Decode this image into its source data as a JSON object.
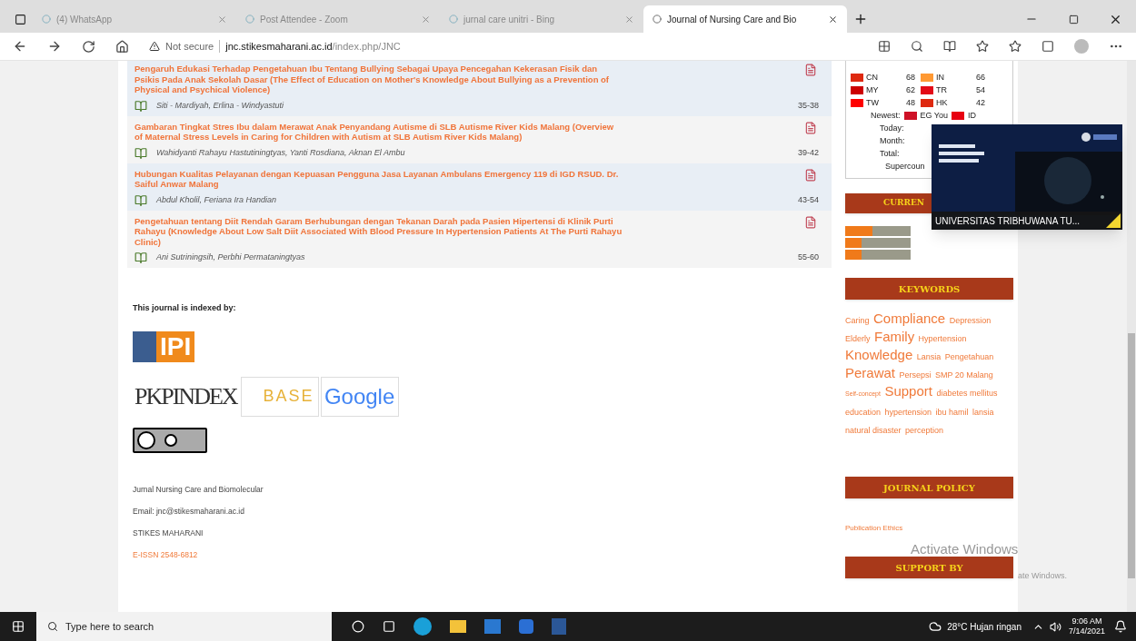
{
  "browser": {
    "tabs": [
      {
        "label": "(4) WhatsApp",
        "selected": false
      },
      {
        "label": "Post Attendee - Zoom",
        "selected": false
      },
      {
        "label": "jurnal care unitri - Bing",
        "selected": false
      },
      {
        "label": "Journal of Nursing Care and Bio",
        "selected": true
      }
    ],
    "security": "Not secure",
    "url_host": "jnc.stikesmaharani.ac.id",
    "url_path": "/index.php/JNC"
  },
  "articles": [
    {
      "title": "Pengaruh Edukasi Terhadap Pengetahuan Ibu Tentang Bullying Sebagai Upaya Pencegahan Kekerasan Fisik dan Psikis Pada Anak Sekolah Dasar (The Effect of Education on Mother's Knowledge About Bullying as a Prevention of Physical and Psychical Violence)",
      "authors": "Siti - Mardiyah, Erlina - Windyastuti",
      "pages": "35-38"
    },
    {
      "title": "Gambaran Tingkat Stres Ibu dalam Merawat Anak Penyandang Autisme di SLB Autisme River Kids Malang (Overview of Maternal Stress Levels in Caring for Children with Autism at SLB Autism River Kids Malang)",
      "authors": "Wahidyanti Rahayu Hastutiningtyas, Yanti Rosdiana, Aknan El Ambu",
      "pages": "39-42"
    },
    {
      "title": "Hubungan Kualitas Pelayanan dengan Kepuasan Pengguna Jasa Layanan Ambulans Emergency 119 di IGD RSUD. Dr. Saiful Anwar Malang",
      "authors": "Abdul Kholil, Feriana Ira Handian",
      "pages": "43-54"
    },
    {
      "title": "Pengetahuan tentang Diit Rendah Garam Berhubungan dengan Tekanan Darah pada Pasien Hipertensi di Klinik Purti Rahayu (Knowledge About Low Salt Diit Associated With Blood Pressure In Hypertension Patients At The Purti Rahayu Clinic)",
      "authors": "Ani Sutriningsih, Perbhi Permataningtyas",
      "pages": "55-60"
    }
  ],
  "indexed": {
    "heading": "This journal is indexed by:",
    "logos": [
      {
        "kind": "ipi",
        "text": "IPI"
      },
      {
        "kind": "pkp",
        "text": "PKPINDEX"
      },
      {
        "kind": "base",
        "text": "BASE"
      },
      {
        "kind": "google",
        "text": "Google"
      }
    ]
  },
  "footer": [
    {
      "text": "Jurnal Nursing Care and Biomolecular",
      "kind": "plain"
    },
    {
      "text": "Email: jnc@stikesmaharani.ac.id",
      "kind": "plain"
    },
    {
      "text": "STIKES MAHARANI",
      "kind": "plain"
    },
    {
      "text": "E-ISSN 2548-6812",
      "kind": "link"
    }
  ],
  "visitors": {
    "countries": [
      {
        "code": "CN",
        "count": "68",
        "color": "#de2910"
      },
      {
        "code": "IN",
        "count": "66",
        "color": "#ff9933"
      },
      {
        "code": "MY",
        "count": "62",
        "color": "#cc0001"
      },
      {
        "code": "TR",
        "count": "54",
        "color": "#e30a17"
      },
      {
        "code": "TW",
        "count": "48",
        "color": "#fe0000"
      },
      {
        "code": "HK",
        "count": "42",
        "color": "#de2910"
      }
    ],
    "newest_label": "Newest:",
    "newest": [
      {
        "code": "EG You",
        "color": "#ce1126"
      },
      {
        "code": "ID",
        "color": "#e70011"
      }
    ],
    "labels": [
      "Today:",
      "Month:",
      "Total:",
      "Supercoun"
    ]
  },
  "sidebar": {
    "current_header": "CURREN",
    "keywords_header": "KEYWORDS",
    "keywords": [
      {
        "text": "Caring",
        "kind": "small"
      },
      {
        "text": "Compliance",
        "kind": "large"
      },
      {
        "text": "Depression",
        "kind": "small"
      },
      {
        "text": "Elderly",
        "kind": "small"
      },
      {
        "text": "Family",
        "kind": "large"
      },
      {
        "text": "Hypertension",
        "kind": "small"
      },
      {
        "text": "Knowledge",
        "kind": "large"
      },
      {
        "text": "Lansia",
        "kind": "small"
      },
      {
        "text": "Pengetahuan",
        "kind": "small"
      },
      {
        "text": "Perawat",
        "kind": "large"
      },
      {
        "text": "Persepsi",
        "kind": "small"
      },
      {
        "text": "SMP 20 Malang",
        "kind": "small"
      },
      {
        "text": "Self-concept",
        "kind": "tiny"
      },
      {
        "text": "Support",
        "kind": "large"
      },
      {
        "text": "diabetes mellitus",
        "kind": "small"
      },
      {
        "text": "education",
        "kind": "small"
      },
      {
        "text": "hypertension",
        "kind": "small"
      },
      {
        "text": "ibu hamil",
        "kind": "small"
      },
      {
        "text": "lansia",
        "kind": "small"
      },
      {
        "text": "natural disaster",
        "kind": "small"
      },
      {
        "text": "perception",
        "kind": "small"
      }
    ],
    "policy_header": "JOURNAL POLICY",
    "policy_link": "Publication Ethics",
    "support_header": "SUPPORT BY"
  },
  "zoom_window": {
    "name": "UNIVERSITAS TRIBHUWANA TU..."
  },
  "activation": {
    "title": "Activate Windows",
    "text": "ate Windows."
  },
  "taskbar": {
    "search_placeholder": "Type here to search",
    "weather": "28°C Hujan ringan",
    "time": "9:06 AM",
    "date": "7/14/2021"
  }
}
